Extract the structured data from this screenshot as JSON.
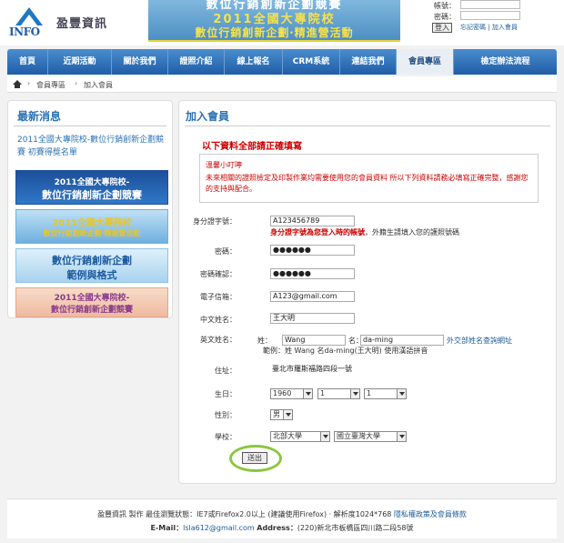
{
  "header": {
    "logo_text": "INFO",
    "brand": "盈豐資訊",
    "banner_line1": "2011全國大專院校",
    "banner_line2": "數位行銷創新企劃‧精進營活動",
    "banner_ghost": "數位行銷創新企劃競賽"
  },
  "login": {
    "account_label": "帳號：",
    "password_label": "密碼：",
    "submit_label": "登入",
    "forgot_link": "忘記密碼",
    "join_link": "加入會員",
    "separator": "|"
  },
  "nav": {
    "items": [
      {
        "label": "首頁"
      },
      {
        "label": "近期活動"
      },
      {
        "label": "關於我們"
      },
      {
        "label": "證照介紹"
      },
      {
        "label": "線上報名"
      },
      {
        "label": "CRM系統"
      },
      {
        "label": "連結我們"
      },
      {
        "label": "會員專區"
      },
      {
        "label": "檢定辦法流程"
      }
    ],
    "active_index": 7
  },
  "breadcrumb": {
    "sep": "›",
    "level1": "會員專區",
    "level2": "加入會員"
  },
  "sidebar": {
    "title": "最新消息",
    "news_link": "2011全國大專院校-數位行銷創新企劃競賽 初賽得獎名單",
    "thumbs": [
      {
        "line1": "2011全國大專院校-",
        "line2": "數位行銷創新企劃競賽"
      },
      {
        "line1": "2011全國大專院校",
        "line2": "數位行銷創新企劃‧精進營活動"
      },
      {
        "line1": "數位行銷創新企劃",
        "line2": "範例與格式"
      },
      {
        "line1": "2011全國大專院校-",
        "line2": "數位行銷創新企劃競賽"
      }
    ]
  },
  "form": {
    "title": "加入會員",
    "required_note": "以下資料全部請正確填寫",
    "warning_title": "溫馨小叮嚀",
    "warning_body": "未來相關的證照檢定及印製作業均需要使用您的會員資料 所以下列資料請務必填寫正確完整，感謝您的支持與配合。",
    "id_label": "身分證字號：",
    "id_value": "A123456789",
    "id_hint_red": "身分證字號為您登入時的帳號",
    "id_hint_rest": "，外籍生請填入您的護照號碼",
    "password_label": "密碼：",
    "password_value": "●●●●●●",
    "confirm_label": "密碼確認：",
    "confirm_value": "●●●●●●",
    "email_label": "電子信箱：",
    "email_value": "A123@gmail.com",
    "cname_label": "中文姓名：",
    "cname_value": "王大明",
    "ename_label": "英文姓名：",
    "surname_prefix": "姓：",
    "surname_value": "Wang",
    "given_prefix": "名：",
    "given_value": "da-ming",
    "ename_link": "外交部姓名查詢網址",
    "ename_example": "範例：姓 Wang 名da-ming(王大明) 使用漢語拼音",
    "address_label": "住址：",
    "address_value": "臺北市羅斯福路四段一號",
    "birth_label": "生日：",
    "birth_year": "1960",
    "birth_month": "1",
    "birth_day": "1",
    "gender_label": "性別：",
    "gender_value": "男",
    "school_label": "學校：",
    "school_region": "北部大學",
    "school_name": "國立臺灣大學",
    "submit_label": "送出"
  },
  "footer": {
    "line1_prefix": "盈豐資訊 製作 最佳瀏覽狀態：IE7或Firefox2.0以上 (建議使用Firefox) ‧ 解析度1024*768",
    "privacy_link": "隱私權政策及會員條款",
    "email_label": "E-Mail：",
    "email_value": "lsla612@gmail.com",
    "address_label": "Address：",
    "address_value": "(220)新北市板橋區四川路二段58號"
  },
  "colors": {
    "nav": "#1f5da8",
    "accent": "#2b72b5",
    "warning": "#cc0000",
    "highlight_ring": "#8cc63f"
  }
}
